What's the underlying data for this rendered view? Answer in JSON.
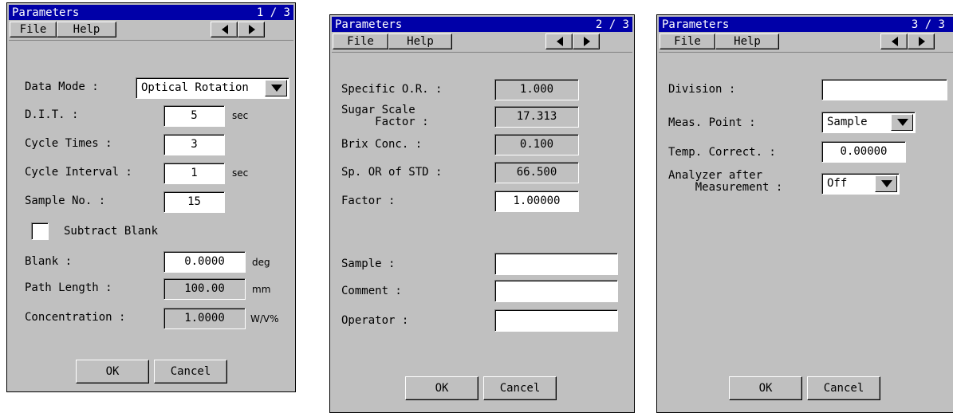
{
  "windows": [
    {
      "title": "Parameters",
      "page": "1 / 3",
      "menu": {
        "file": "File",
        "help": "Help"
      },
      "data_mode": {
        "label": "Data Mode :",
        "value": "Optical Rotation"
      },
      "dit": {
        "label": "D.I.T. :",
        "value": "5",
        "unit": "sec"
      },
      "cycle_times": {
        "label": "Cycle Times :",
        "value": "3"
      },
      "cycle_interval": {
        "label": "Cycle Interval :",
        "value": "1",
        "unit": "sec"
      },
      "sample_no": {
        "label": "Sample No. :",
        "value": "15"
      },
      "subtract_blank": {
        "label": "Subtract Blank",
        "checked": false
      },
      "blank": {
        "label": "Blank :",
        "value": "0.0000",
        "unit": "deg"
      },
      "path_length": {
        "label": "Path Length :",
        "value": "100.00",
        "unit": "mm"
      },
      "concentration": {
        "label": "Concentration :",
        "value": "1.0000",
        "unit": "W/V%"
      },
      "ok": "OK",
      "cancel": "Cancel"
    },
    {
      "title": "Parameters",
      "page": "2 / 3",
      "menu": {
        "file": "File",
        "help": "Help"
      },
      "specific_or": {
        "label": "Specific O.R. :",
        "value": "1.000"
      },
      "sugar_scale": {
        "label": "Sugar Scale\n     Factor :",
        "value": "17.313"
      },
      "brix": {
        "label": "Brix Conc. :",
        "value": "0.100"
      },
      "sp_or_std": {
        "label": "Sp. OR of STD :",
        "value": "66.500"
      },
      "factor": {
        "label": "Factor :",
        "value": "1.00000"
      },
      "sample": {
        "label": "Sample :",
        "value": ""
      },
      "comment": {
        "label": "Comment :",
        "value": ""
      },
      "operator": {
        "label": "Operator :",
        "value": ""
      },
      "ok": "OK",
      "cancel": "Cancel"
    },
    {
      "title": "Parameters",
      "page": "3 / 3",
      "menu": {
        "file": "File",
        "help": "Help"
      },
      "division": {
        "label": "Division :",
        "value": ""
      },
      "meas_point": {
        "label": "Meas. Point :",
        "value": "Sample"
      },
      "temp_correct": {
        "label": "Temp. Correct. :",
        "value": "0.00000"
      },
      "analyzer": {
        "label": "Analyzer after\n    Measurement :",
        "value": "Off"
      },
      "ok": "OK",
      "cancel": "Cancel"
    }
  ]
}
